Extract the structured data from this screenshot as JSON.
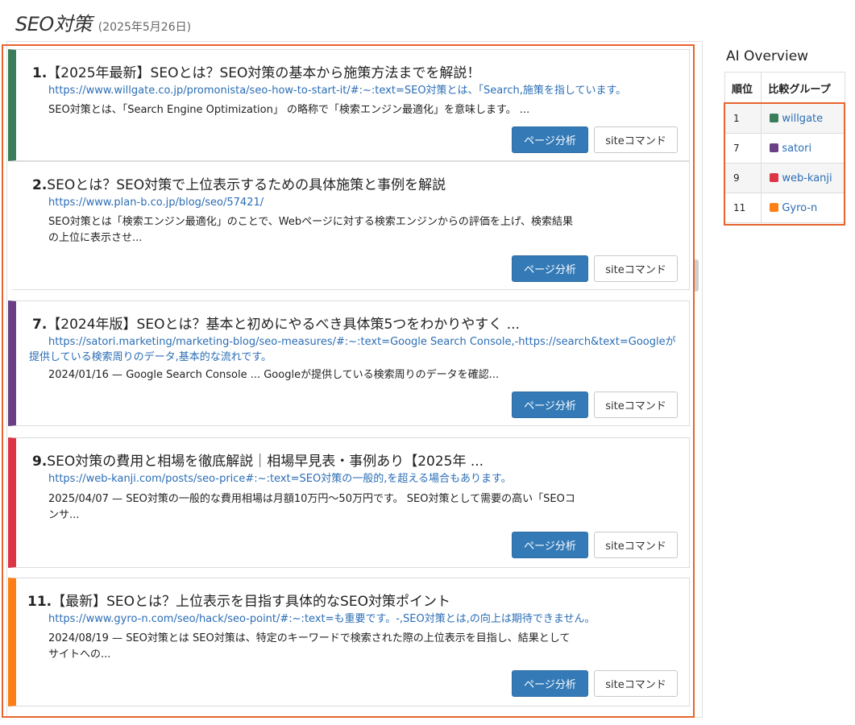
{
  "header": {
    "title": "SEO対策",
    "date": "(2025年5月26日)"
  },
  "buttons": {
    "analyze": "ページ分析",
    "site": "siteコマンド"
  },
  "results": [
    {
      "rank": "1.",
      "title": "【2025年最新】SEOとは？SEO対策の基本から施策方法までを解説！",
      "url": "https://www.willgate.co.jp/promonista/seo-how-to-start-it/#:~:text=SEO対策とは、「Search,施策を指しています。",
      "snippet": "SEO対策とは、「Search Engine Optimization」 の略称で「検索エンジン最適化」を意味します。 ...",
      "color": "#3a7d5a"
    },
    {
      "rank": "2.",
      "title": "SEOとは？SEO対策で上位表示するための具体施策と事例を解説",
      "url": "https://www.plan-b.co.jp/blog/seo/57421/",
      "snippet": "SEO対策とは「検索エンジン最適化」のことで、Webページに対する検索エンジンからの評価を上げ、検索結果の上位に表示させ...",
      "color": "#ffffff"
    },
    {
      "rank": "7.",
      "title": "【2024年版】SEOとは？基本と初めにやるべき具体策5つをわかりやすく ...",
      "url": "https://satori.marketing/marketing-blog/seo-measures/#:~:text=Google Search Console,-https://search&text=Googleが提供している検索周りのデータ,基本的な流れです。",
      "snippet": "2024/01/16 — Google Search Console ... Googleが提供している検索周りのデータを確認...",
      "color": "#6a3f86"
    },
    {
      "rank": "9.",
      "title": "SEO対策の費用と相場を徹底解説｜相場早見表・事例あり【2025年 ...",
      "url": "https://web-kanji.com/posts/seo-price#:~:text=SEO対策の一般的,を超える場合もあります。",
      "snippet": "2025/04/07 — SEO対策の一般的な費用相場は月額10万円〜50万円です。 SEO対策として需要の高い「SEOコンサ...",
      "color": "#dc3545"
    },
    {
      "rank": "11.",
      "title": "【最新】SEOとは？上位表示を目指す具体的なSEO対策ポイント",
      "url": "https://www.gyro-n.com/seo/hack/seo-point/#:~:text=も重要です。-,SEO対策とは,の向上は期待できません。",
      "snippet": "2024/08/19 — SEO対策とは SEO対策は、特定のキーワードで検索された際の上位表示を目指し、結果としてサイトへの...",
      "color": "#fd7e14"
    }
  ],
  "ai_overview": {
    "title": "AI Overview",
    "headers": [
      "順位",
      "比較グループ"
    ],
    "rows": [
      {
        "rank": "1",
        "group": "willgate",
        "color": "#3a7d5a"
      },
      {
        "rank": "7",
        "group": "satori",
        "color": "#6a3f86"
      },
      {
        "rank": "9",
        "group": "web-kanji",
        "color": "#dc3545"
      },
      {
        "rank": "11",
        "group": "Gyro-n",
        "color": "#fd7e14"
      }
    ]
  }
}
